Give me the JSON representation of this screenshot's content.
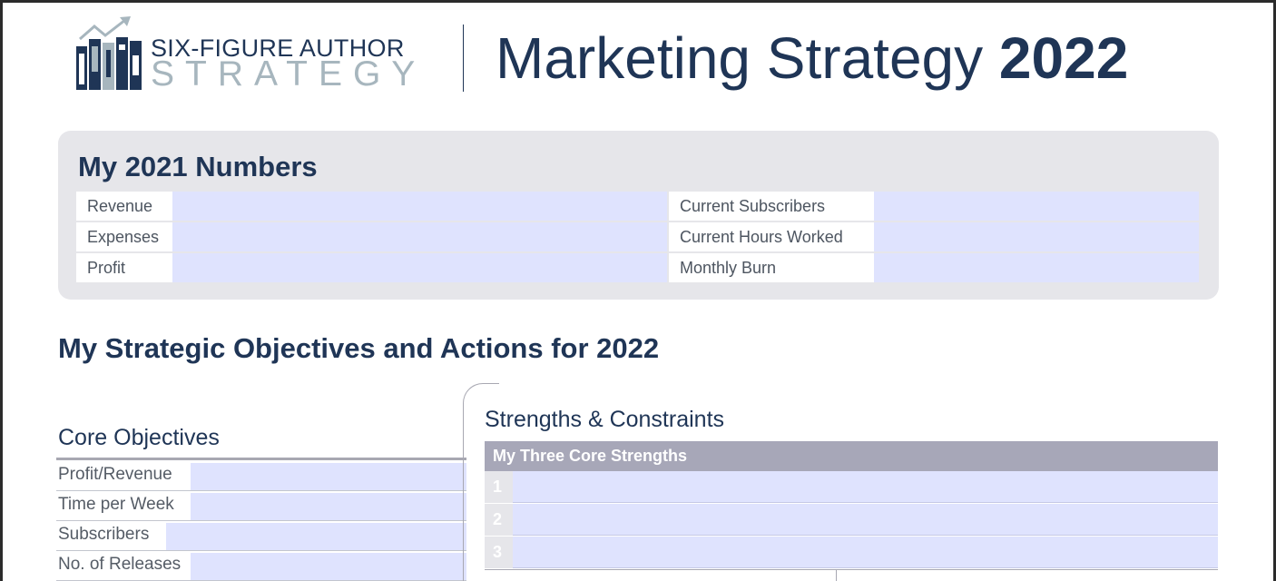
{
  "logo": {
    "line1": "SIX-FIGURE AUTHOR",
    "line2": "STRATEGY",
    "icon": "books-growth-icon"
  },
  "title": {
    "text": "Marketing Strategy ",
    "year": "2022"
  },
  "numbers": {
    "title_pre": "My ",
    "title_year": "2021",
    "title_post": " Numbers",
    "left": [
      "Revenue",
      "Expenses",
      "Profit"
    ],
    "right": [
      "Current Subscribers",
      "Current Hours Worked",
      "Monthly Burn"
    ]
  },
  "strategic": {
    "heading_pre": "My Strategic Objectives and Actions for ",
    "heading_year": "2022"
  },
  "core": {
    "title": "Core Objectives",
    "rows": [
      "Profit/Revenue",
      "Time per Week",
      "Subscribers",
      "No. of Releases"
    ]
  },
  "strengths": {
    "title": "Strengths & Constraints",
    "header": "My Three Core Strengths",
    "rows": [
      "1",
      "2",
      "3"
    ]
  },
  "colors": {
    "navy": "#1f3556",
    "field_blue": "#dfe3fe",
    "panel_gray": "#e6e6ea",
    "header_gray": "#a7a7b8",
    "logo_light": "#a7b6be"
  }
}
